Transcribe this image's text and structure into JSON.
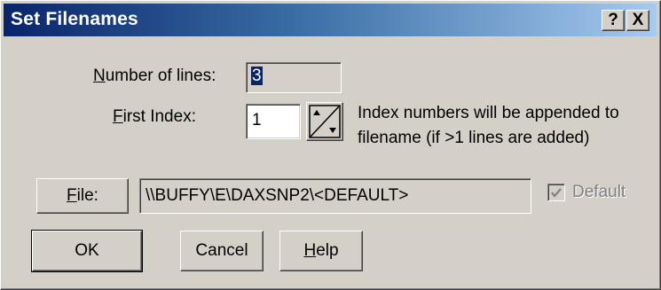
{
  "window": {
    "title": "Set Filenames",
    "help_button": "?",
    "close_button": "X"
  },
  "lines": {
    "label_prefix": "N",
    "label_rest": "umber of lines:",
    "value": "3"
  },
  "first_index": {
    "label_prefix": "F",
    "label_rest": "irst Index:",
    "value": "1",
    "hint_line1": "Index numbers will be appended to",
    "hint_line2": "filename (if >1 lines are added)"
  },
  "file": {
    "button_prefix": "F",
    "button_rest": "ile:",
    "path": "\\\\BUFFY\\E\\DAXSNP2\\<DEFAULT>",
    "default_label": "Default",
    "default_checked": true,
    "default_enabled": false
  },
  "buttons": {
    "ok": "OK",
    "cancel": "Cancel",
    "help_prefix": "H",
    "help_rest": "elp"
  },
  "colors": {
    "title_bar_start": "#0a246a",
    "title_bar_end": "#a6caf0",
    "dialog_face": "#d4d0c8",
    "disabled_text": "#808080"
  }
}
